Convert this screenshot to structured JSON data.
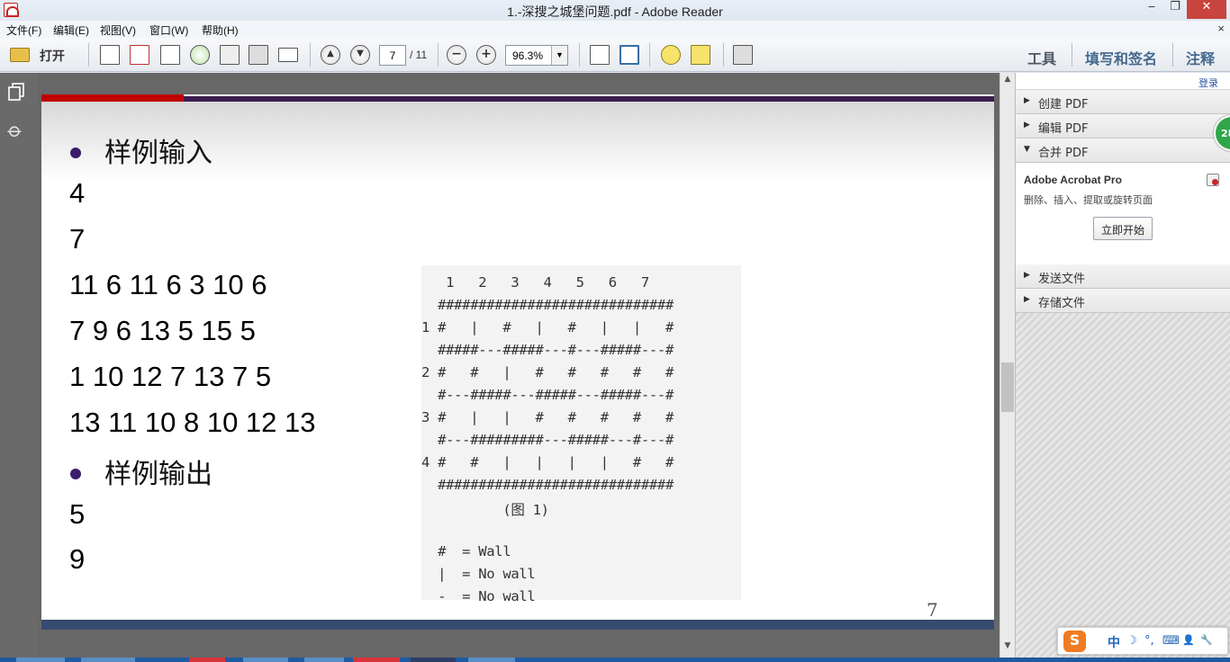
{
  "window": {
    "title": "1.-深搜之城堡问题.pdf - Adobe Reader",
    "min": "‒",
    "max": "❐",
    "close": "✕"
  },
  "menu": [
    "文件(F)",
    "编辑(E)",
    "视图(V)",
    "窗口(W)",
    "帮助(H)"
  ],
  "menu_close": "×",
  "toolbar": {
    "open_label": "打开",
    "page_current": "7",
    "page_total": "/ 11",
    "zoom": "96.3%",
    "prev_page": "▲",
    "next_page": "▼",
    "zoom_out": "−",
    "zoom_in": "+",
    "zoom_dd": "▼",
    "tools": "工具",
    "fill_sign": "填写和签名",
    "comment": "注释"
  },
  "rail": {
    "clip_icon": "⌀"
  },
  "document": {
    "heading_input": "样例输入",
    "heading_output": "样例输出",
    "input_lines": [
      "4",
      "7",
      "11 6 11 6 3 10 6",
      "7 9 6 13 5 15 5",
      "1 10 12 7 13 7 5",
      "13 11 10 8 10 12 13"
    ],
    "output_lines": [
      "5",
      "9"
    ],
    "figure_lines": [
      "   1   2   3   4   5   6   7",
      "  #############################",
      "1 #   |   #   |   #   |   |   #",
      "  #####---#####---#---#####---#",
      "2 #   #   |   #   #   #   #   #",
      "  #---#####---#####---#####---#",
      "3 #   |   |   #   #   #   #   #",
      "  #---#########---#####---#---#",
      "4 #   #   |   |   |   |   #   #",
      "  #############################",
      "          (图 1)",
      "",
      "  #  = Wall",
      "  |  = No wall",
      "  -  = No wall"
    ],
    "page_number": "7"
  },
  "scrollbar": {
    "up": "▲",
    "down": "▼"
  },
  "right_pane": {
    "login": "登录",
    "collapsed_arrow": "▶",
    "expanded_arrow": "▼",
    "sections": [
      "创建 PDF",
      "编辑 PDF",
      "合并 PDF",
      "发送文件",
      "存储文件"
    ],
    "acrobat_title": "Adobe Acrobat Pro",
    "acrobat_desc": "删除、插入、提取或旋转页面",
    "start_button": "立即开始"
  },
  "badge": "28",
  "ime": {
    "logo": "S",
    "text": "中",
    "icons": [
      "☽",
      "°,",
      "⌨",
      "👤",
      "🔧"
    ]
  },
  "colors": {
    "accent_red": "#c00000",
    "page_bar": "#374a70",
    "bullet": "#3b1d6b",
    "link": "#2a56a8"
  }
}
